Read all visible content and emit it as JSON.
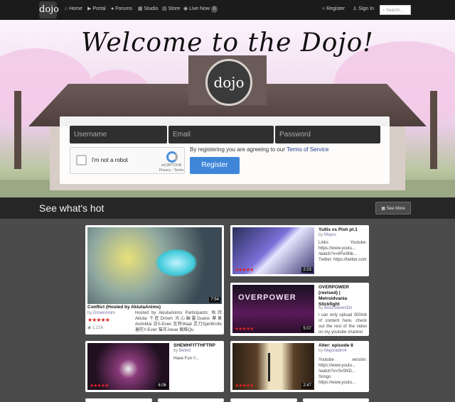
{
  "nav": {
    "logo": "dojo",
    "items": [
      {
        "icon": "⌂",
        "label": "Home"
      },
      {
        "icon": "▶",
        "label": "Portal"
      },
      {
        "icon": "●",
        "label": "Forums"
      },
      {
        "icon": "▦",
        "label": "Studio"
      },
      {
        "icon": "▤",
        "label": "Store"
      },
      {
        "icon": "◉",
        "label": "Live Now"
      }
    ],
    "live_count": "0",
    "register": "Register",
    "signin": "Sign In",
    "search_placeholder": "Search"
  },
  "hero": {
    "title": "Welcome to the Dojo!",
    "emblem": "dojo"
  },
  "form": {
    "username_placeholder": "Username",
    "email_placeholder": "Email",
    "password_placeholder": "Password",
    "captcha_label": "I'm not a robot",
    "captcha_brand": "reCAPTCHA",
    "captcha_links": "Privacy - Terms",
    "tos_prefix": "By registering you are agreeing to our ",
    "tos_link": "Terms of Service",
    "register_button": "Register"
  },
  "hot": {
    "title": "See what's hot",
    "see_more": "See More"
  },
  "cards": [
    {
      "title": "Conflict (Hosted by AkiutaAnims)",
      "by": "by",
      "author": "DrownAnim",
      "duration": "7:54",
      "views": "1,226",
      "desc": "Hosted by AkiutaAnims Participants: 秋詩Akiuta 千匠Drown 光心幽靈Guanx 摹東AnimMai 流S-Even 瓦特Waat 灵刀SpiritKnife 善陀Y-Evier 猫牙Joeax 蜘蛛Qu"
    },
    {
      "title": "Yullis vs Pish pt.1",
      "by": "by",
      "author": "Mayru",
      "duration": "2:23",
      "desc": "Links Youtube: https://www.youtu... /watch?v=6Fw9Nk... Twitter: https://twitter.com"
    },
    {
      "title": "OVERPOWER (revised) | Metroidvania Stickfight",
      "by": "by",
      "author": "BossSlevenDo",
      "duration": "5:07",
      "desc": "i can only upload 300mb of content here, check out the rest of the video on my youtube channel",
      "thumb_text": "OVERPOWER"
    },
    {
      "title": "SHEMHFITTHFTRP",
      "by": "by",
      "author": "Betelz",
      "duration": "6:06",
      "desc": "Have Fun !!..."
    },
    {
      "title": "Alter: episode 8",
      "by": "by",
      "author": "Majoradim4",
      "duration": "2:47",
      "desc": "Youtube version: https://www.youtu... /watch?v=SxSND... Songs: https://www.youtu..."
    }
  ],
  "colors": {
    "accent": "#3f86d9",
    "star": "#dd2222",
    "topbar": "#1b1b1b"
  }
}
